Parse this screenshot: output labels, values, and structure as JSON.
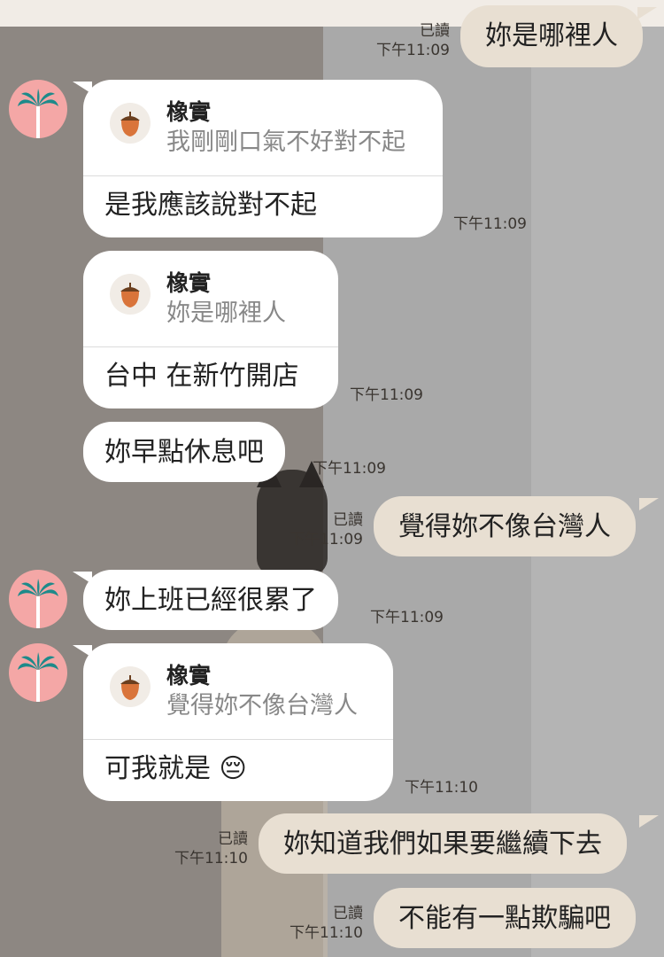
{
  "messages": [
    {
      "side": "out",
      "text": "妳是哪裡人",
      "read": "已讀",
      "time": "下午11:09"
    },
    {
      "side": "in",
      "quote_name": "橡實",
      "quote_text": "我剛剛口氣不好對不起",
      "text": "是我應該說對不起",
      "time": "下午11:09"
    },
    {
      "side": "in",
      "quote_name": "橡實",
      "quote_text": "妳是哪裡人",
      "text": "台中 在新竹開店",
      "time": "下午11:09"
    },
    {
      "side": "in",
      "text": "妳早點休息吧",
      "time": "下午11:09"
    },
    {
      "side": "out",
      "text": "覺得妳不像台灣人",
      "read": "已讀",
      "time": "下午11:09"
    },
    {
      "side": "in",
      "text": "妳上班已經很累了",
      "time": "下午11:09"
    },
    {
      "side": "in",
      "quote_name": "橡實",
      "quote_text": "覺得妳不像台灣人",
      "text": "可我就是",
      "emoji": "😔",
      "time": "下午11:10"
    },
    {
      "side": "out",
      "text": "妳知道我們如果要繼續下去",
      "read": "已讀",
      "time": "下午11:10"
    },
    {
      "side": "out",
      "text": "不能有一點欺騙吧",
      "read": "已讀",
      "time": "下午11:10"
    }
  ],
  "colors": {
    "out_bubble": "#e8dfd2",
    "in_bubble": "#ffffff",
    "avatar_bg": "#f4a7a6",
    "palm": "#1d8a8a"
  },
  "icons": {
    "avatar": "palm-tree-icon",
    "quote": "acorn-icon"
  }
}
